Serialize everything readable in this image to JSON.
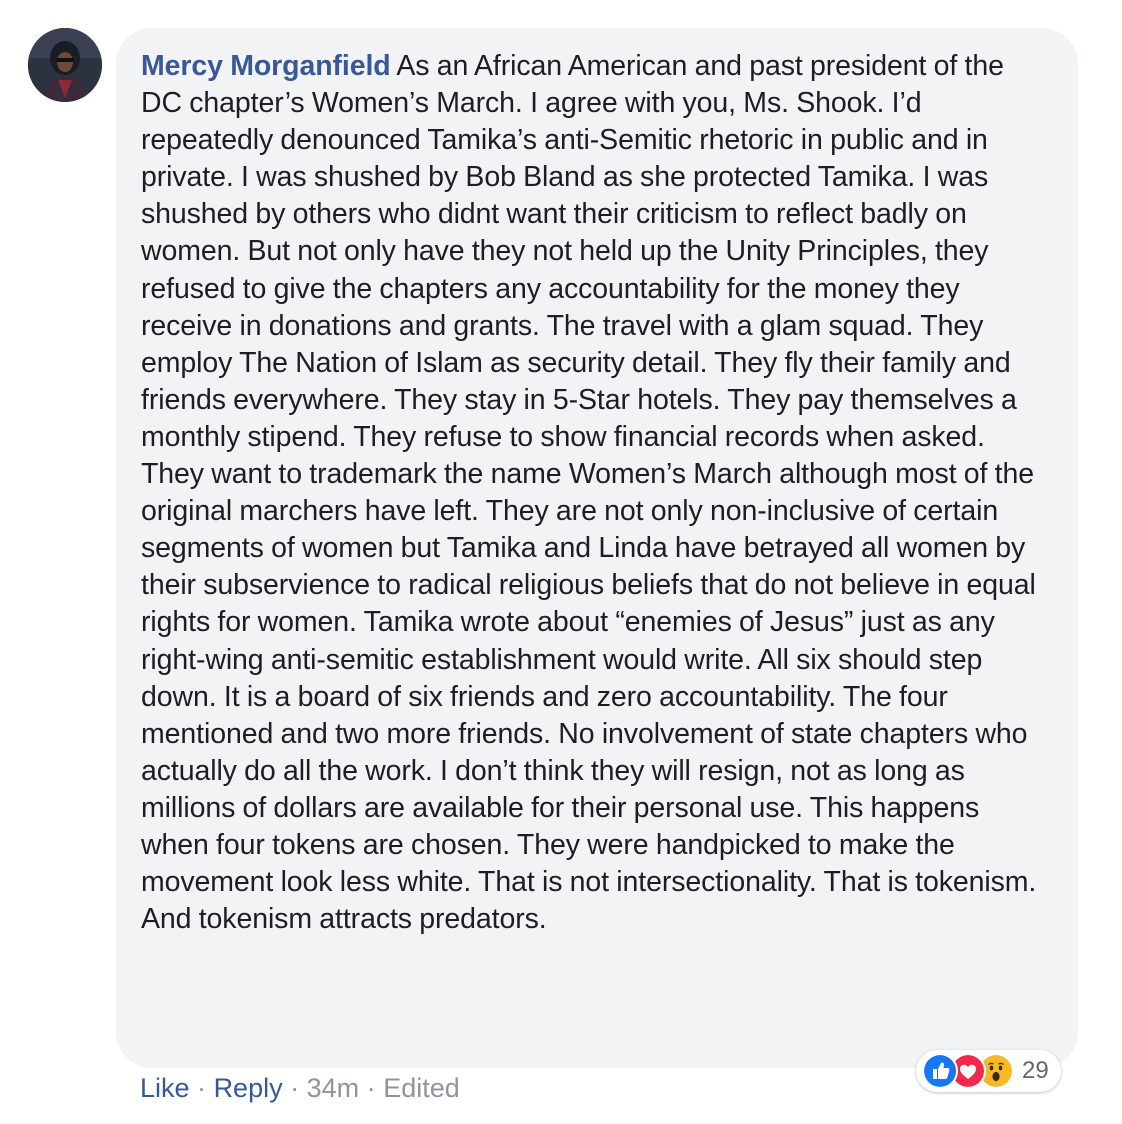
{
  "comment": {
    "author": "Mercy Morganfield",
    "text": "As an African American and past president of the DC chapter’s Women’s March. I agree with you, Ms. Shook. I’d repeatedly denounced Tamika’s anti-Semitic rhetoric in public and in private. I was shushed by Bob Bland as she protected Tamika. I was shushed by others who didnt want their criticism to reflect badly on women. But not only have they not held up the Unity Principles, they refused to give the chapters any accountability for the money they receive in donations and grants. The travel with a glam squad. They employ The Nation of Islam as security detail. They fly their family and friends everywhere. They stay in 5-Star hotels. They pay themselves a monthly stipend. They refuse to show financial records when asked. They want to trademark the name Women’s March although most of the original marchers have left. They are not only non-inclusive of certain segments of women but Tamika and Linda have betrayed all women by their subservience to radical religious beliefs that do not believe in equal rights for women. Tamika wrote about “enemies of Jesus” just as any right-wing anti-semitic establishment would write. All six should step down. It is a board of six friends and zero accountability. The four mentioned and two more friends. No involvement of state chapters who actually do all the work. I don’t think they will resign, not as long as millions of dollars are available for their personal use. This happens when four tokens are chosen. They were handpicked to make the movement look less white. That is not intersectionality. That is tokenism. And tokenism attracts predators.",
    "avatar_icon": "user-avatar-icon"
  },
  "actions": {
    "like_label": "Like",
    "reply_label": "Reply",
    "timestamp": "34m",
    "edited_label": "Edited",
    "separator": "·"
  },
  "reactions": {
    "icons": [
      "like-reaction-icon",
      "love-reaction-icon",
      "wow-reaction-icon"
    ],
    "count": "29"
  },
  "colors": {
    "bubble_bg": "#f2f3f5",
    "author_link": "#385898",
    "body_text": "#1c1e21",
    "meta_text": "#90949c",
    "like_blue": "#1877f2",
    "love_red": "#f0284a",
    "wow_yellow": "#f7b928"
  }
}
